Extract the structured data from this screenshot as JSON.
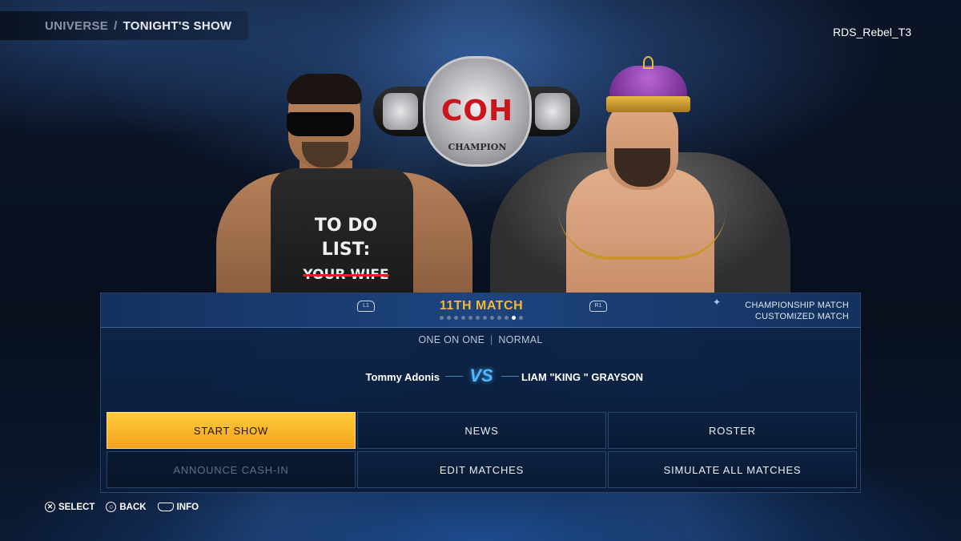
{
  "header": {
    "breadcrumb_parent": "UNIVERSE",
    "breadcrumb_separator": "/",
    "breadcrumb_current": "TONIGHT'S SHOW",
    "username": "RDS_Rebel_T3"
  },
  "scene": {
    "shirt_line1": "TO DO LIST:",
    "shirt_line2": "YOUR WIFE",
    "belt_logo": "COH",
    "belt_label": "CHAMPION"
  },
  "match": {
    "prev_button": "L1",
    "next_button": "R1",
    "title": "11TH MATCH",
    "total_matches": 12,
    "current_index": 11,
    "tag_line1": "CHAMPIONSHIP MATCH",
    "tag_line2": "CUSTOMIZED MATCH",
    "type": "ONE ON ONE",
    "type_separator": "|",
    "difficulty": "NORMAL",
    "competitor_left": "Tommy Adonis",
    "vs_label": "VS",
    "competitor_right": "LIAM \"KING \" GRAYSON"
  },
  "menu": {
    "start_show": "START SHOW",
    "news": "NEWS",
    "roster": "ROSTER",
    "announce_cash_in": "ANNOUNCE CASH-IN",
    "edit_matches": "EDIT MATCHES",
    "simulate_all": "SIMULATE ALL MATCHES"
  },
  "footer": {
    "select_icon": "cross-icon",
    "select_label": "SELECT",
    "back_icon": "circle-icon",
    "back_label": "BACK",
    "info_icon": "touchpad-icon",
    "info_label": "INFO"
  },
  "colors": {
    "accent_gold": "#f5b73a",
    "selected_button": "#ffcc3a",
    "vs_blue": "#4fb6ff",
    "panel_blue": "#0e284e"
  }
}
